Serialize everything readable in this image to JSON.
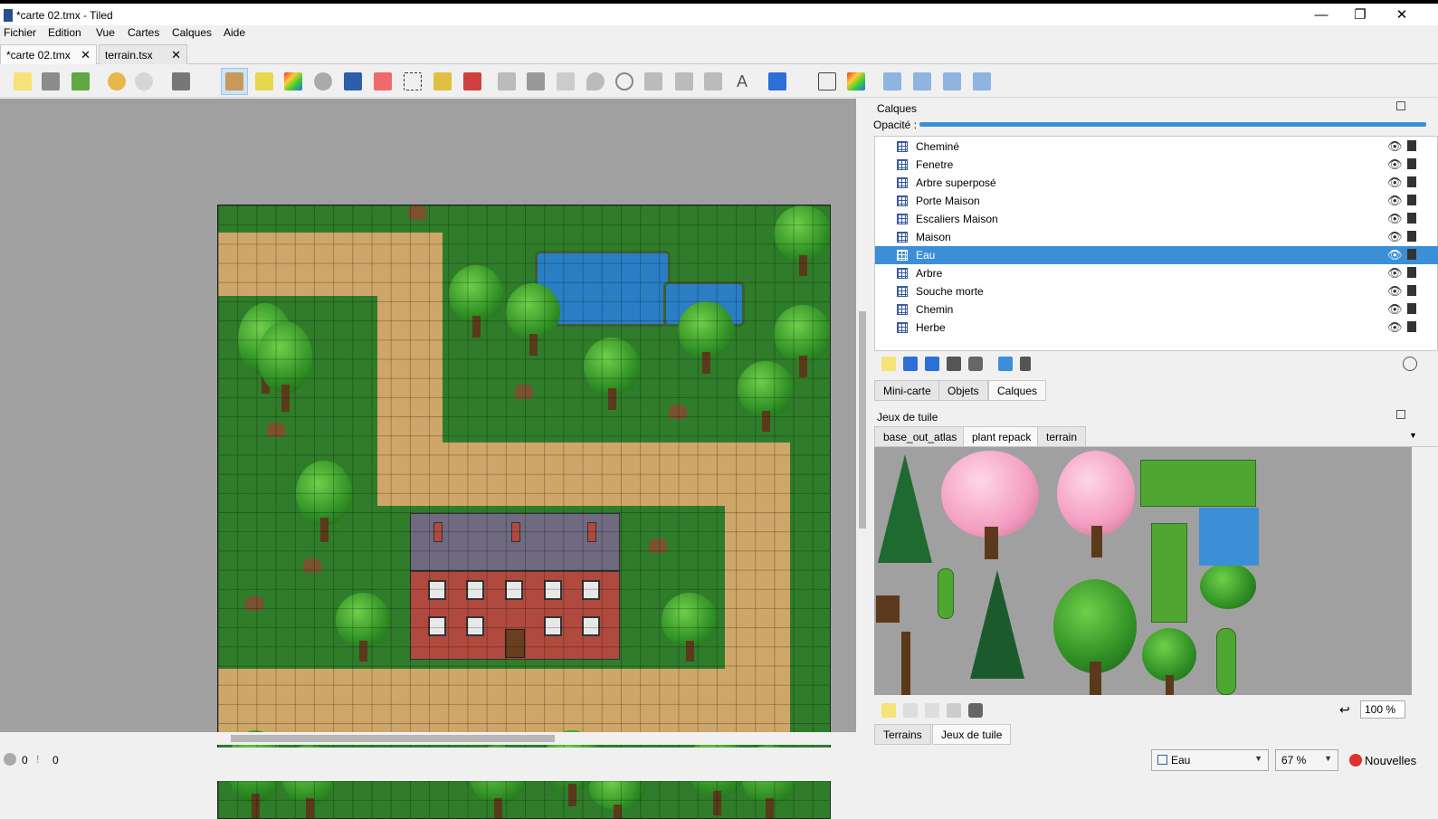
{
  "window": {
    "title": "*carte 02.tmx - Tiled"
  },
  "menu": [
    "Fichier",
    "Edition",
    "Vue",
    "Cartes",
    "Calques",
    "Aide"
  ],
  "doc_tabs": [
    {
      "label": "*carte 02.tmx",
      "close": "✕"
    },
    {
      "label": "terrain.tsx",
      "close": "✕"
    }
  ],
  "window_controls": {
    "minimize": "—",
    "restore": "❐",
    "close": "✕"
  },
  "layers_panel": {
    "title": "Calques",
    "opacity_label": "Opacité :",
    "opacity": 1.0,
    "layers": [
      "Cheminé",
      "Fenetre",
      "Arbre superposé",
      "Porte Maison",
      "Escaliers Maison",
      "Maison",
      "Eau",
      "Arbre",
      "Souche morte",
      "Chemin",
      "Herbe"
    ],
    "selected": "Eau"
  },
  "mid_tabs": [
    "Mini-carte",
    "Objets",
    "Calques"
  ],
  "mid_tab_active": "Calques",
  "tilesets_panel": {
    "title": "Jeux de tuile",
    "tabs": [
      "base_out_atlas",
      "plant repack",
      "terrain"
    ],
    "active_tab": "plant repack",
    "zoom": "100 %"
  },
  "bottom_tabs": [
    "Terrains",
    "Jeux de tuile"
  ],
  "bottom_tab_active": "Jeux de tuile",
  "status": {
    "errors": "0",
    "warnings": "0",
    "current_layer": "Eau",
    "zoom": "67 %",
    "news": "Nouvelles"
  },
  "colors": {
    "accent": "#3c8fd6",
    "grass": "#2f7d2b",
    "path": "#cfa66a",
    "water": "#2a7fc4"
  }
}
